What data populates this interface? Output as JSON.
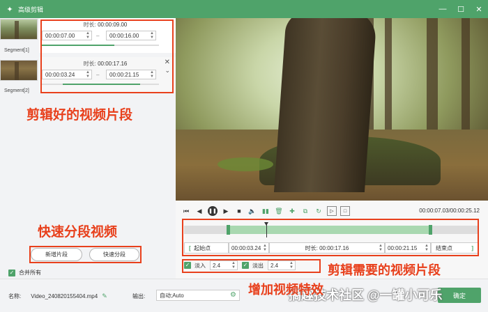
{
  "window": {
    "title": "高级剪辑"
  },
  "segments": [
    {
      "label": "Segment[1]",
      "duration_label": "时长:",
      "duration": "00:00:09.00",
      "start": "00:00:07.00",
      "end": "00:00:16.00",
      "bar_fill_start": 0.0,
      "bar_fill_end": 0.62
    },
    {
      "label": "Segment[2]",
      "duration_label": "时长:",
      "duration": "00:00:17.16",
      "start": "00:00:03.24",
      "end": "00:00:21.15",
      "bar_fill_start": 0.18,
      "bar_fill_end": 0.84
    }
  ],
  "annotations": {
    "edited_segments": "剪辑好的视频片段",
    "quick_split": "快速分段视频",
    "needed_segment": "剪辑需要的视频片段",
    "add_transition": "增加视频特效"
  },
  "buttons": {
    "add_segment": "新增片段",
    "quick_split": "快速分段"
  },
  "merge": {
    "label": "合并所有",
    "checked": true
  },
  "player": {
    "time_readout": "00:00:07.03/00:00:25.12",
    "selection_start_fraction": 0.15,
    "selection_end_fraction": 0.84,
    "playhead_fraction": 0.28
  },
  "trim": {
    "start_point_label": "起始点",
    "start_value": "00:00:03.24",
    "duration_label": "时长:",
    "duration_value": "00:00:17.16",
    "end_value": "00:00:21.15",
    "end_point_label": "结束点"
  },
  "fade": {
    "fade_in_label": "淡入",
    "fade_in_value": "2.4",
    "fade_in_checked": true,
    "fade_out_label": "淡出",
    "fade_out_value": "2.4",
    "fade_out_checked": true
  },
  "bottom": {
    "name_label": "名称:",
    "file_name": "Video_240820155404.mp4",
    "output_label": "输出:",
    "output_value": "自动;Auto",
    "watermark": "搞趣技术社区 @一罐小可乐",
    "export_label": "确定"
  },
  "colors": {
    "accent": "#4fa36a",
    "annotation": "#e8401c"
  },
  "icons": [
    "app-logo-icon",
    "minimize-icon",
    "maximize-icon",
    "close-icon",
    "pencil-icon",
    "gear-icon"
  ]
}
